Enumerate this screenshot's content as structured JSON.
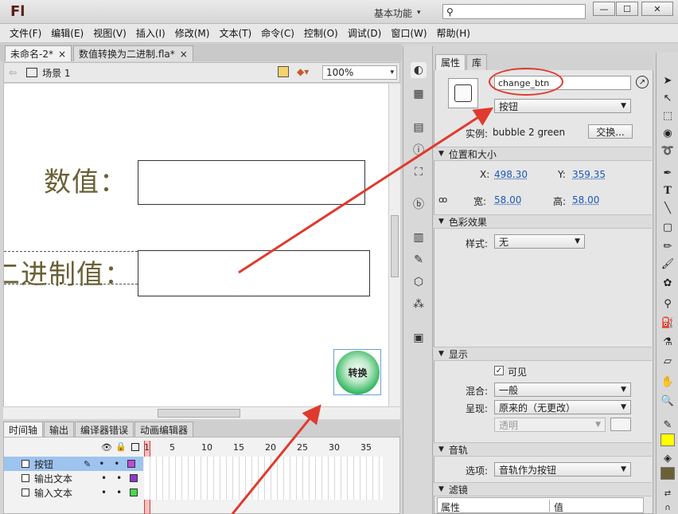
{
  "app": {
    "logo": "Fl",
    "workspace": "基本功能",
    "search_placeholder": ""
  },
  "window_buttons": {
    "minimize": "—",
    "maximize": "☐",
    "close": "✕"
  },
  "menu": [
    "文件(F)",
    "编辑(E)",
    "视图(V)",
    "插入(I)",
    "修改(M)",
    "文本(T)",
    "命令(C)",
    "控制(O)",
    "调试(D)",
    "窗口(W)",
    "帮助(H)"
  ],
  "doc_tabs": [
    {
      "label": "未命名-2*",
      "close": "×"
    },
    {
      "label": "数值转换为二进制.fla*",
      "close": "×"
    }
  ],
  "scene": {
    "label": "场景 1",
    "zoom": "100%"
  },
  "stage": {
    "label_value": "数值：",
    "label_binary": "二进制值：",
    "button_text": "转换"
  },
  "timeline_tabs": [
    "时间轴",
    "输出",
    "编译器错误",
    "动画编辑器"
  ],
  "frame_numbers": [
    "1",
    "5",
    "10",
    "15",
    "20",
    "25",
    "30",
    "35"
  ],
  "layers": [
    {
      "name": "按钮",
      "color": "#c04ad8",
      "selected": true
    },
    {
      "name": "输出文本",
      "color": "#8a3cc8",
      "selected": false
    },
    {
      "name": "输入文本",
      "color": "#4ad84a",
      "selected": false
    }
  ],
  "props": {
    "tabs": [
      "属性",
      "库"
    ],
    "instance_name": "change_btn",
    "symbol_type": "按钮",
    "instance_of_label": "实例:",
    "instance_of": "bubble 2 green",
    "swap_button": "交换...",
    "section_position": "位置和大小",
    "x_label": "X:",
    "x_value": "498.30",
    "y_label": "Y:",
    "y_value": "359.35",
    "w_label": "宽:",
    "w_value": "58.00",
    "h_label": "高:",
    "h_value": "58.00",
    "section_color": "色彩效果",
    "style_label": "样式:",
    "style_value": "无",
    "section_display": "显示",
    "visible_label": "可见",
    "blend_label": "混合:",
    "blend_value": "一般",
    "render_label": "呈现:",
    "render_value": "原来的（无更改）",
    "transparent_value": "透明",
    "section_track": "音轨",
    "track_label": "选项:",
    "track_value": "音轨作为按钮",
    "section_filter": "滤镜",
    "filter_col1": "属性",
    "filter_col2": "值"
  },
  "colors": {
    "annotation_red": "#e03a2e",
    "highlight": "#ffff00",
    "olive": "#6b6035"
  }
}
